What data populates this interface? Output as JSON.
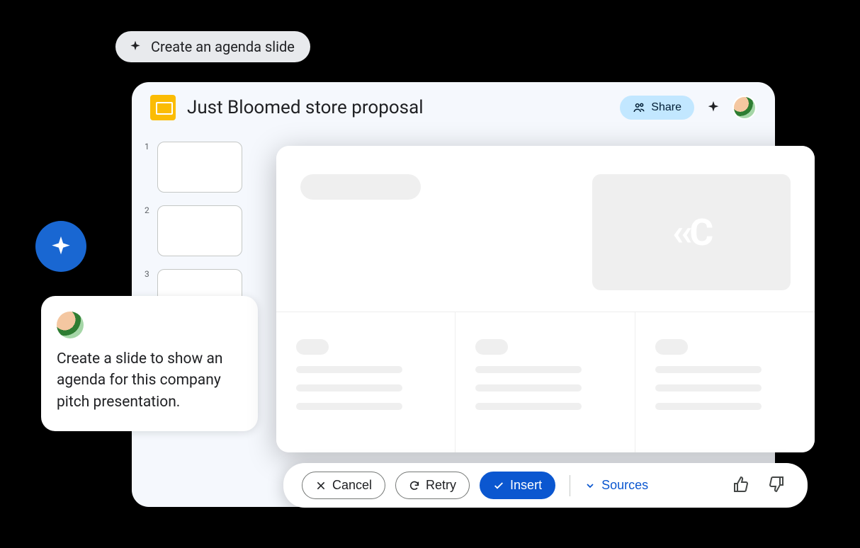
{
  "suggestion": {
    "label": "Create an agenda slide"
  },
  "doc": {
    "title": "Just Bloomed store proposal"
  },
  "header": {
    "share_label": "Share"
  },
  "thumbs": [
    {
      "num": "1"
    },
    {
      "num": "2"
    },
    {
      "num": "3"
    }
  ],
  "prompt": {
    "text": "Create a slide to show an agenda for this company pitch presentation."
  },
  "actions": {
    "cancel": "Cancel",
    "retry": "Retry",
    "insert": "Insert",
    "sources": "Sources"
  },
  "placeholder_logo": "‹‹C"
}
